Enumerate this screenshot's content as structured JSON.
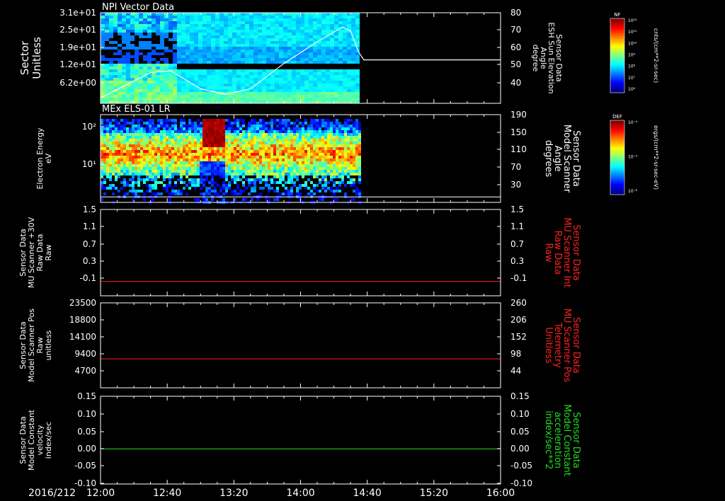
{
  "date_label": "2016/212",
  "time_ticks": [
    "12:00",
    "12:40",
    "13:20",
    "14:00",
    "14:40",
    "15:20",
    "16:00"
  ],
  "panels": [
    {
      "title": "NPI Vector Data",
      "ylabel_lines": [
        "Sector",
        "Unitless"
      ],
      "left_ticks": [
        "3.1e+01",
        "2.5e+01",
        "1.9e+01",
        "1.2e+01",
        "6.2e+00"
      ],
      "right_ticks": [
        "80",
        "70",
        "60",
        "50",
        "40"
      ],
      "right_label_lines": [
        "Sensor Data",
        "ESH Sun Elevation",
        "Angle",
        "degree"
      ],
      "right_label_color": "#ffffff",
      "colorbar": {
        "tag": "NF",
        "unit": "cnts/(cm**2-sr-sec)",
        "labels": [
          "10¹²",
          "10¹¹",
          "10¹⁰",
          "10⁹",
          "10⁸",
          "10⁷",
          "10⁶"
        ]
      }
    },
    {
      "title": "MEx ELS-01 LR",
      "ylabel_lines": [
        "Electron Energy",
        "eV"
      ],
      "left_ticks": [
        "10²",
        "10¹"
      ],
      "right_ticks": [
        "190",
        "150",
        "110",
        "70",
        "30"
      ],
      "right_label_lines": [
        "Sensor Data",
        "Model Scanner",
        "Angle",
        "degrees"
      ],
      "right_label_color": "#ffffff",
      "colorbar": {
        "tag": "DEF",
        "unit": "ergs/(cm**2-sr-sec-eV)",
        "labels": [
          "10⁻⁴",
          "10⁻⁵",
          "10⁻⁶"
        ]
      }
    },
    {
      "ylabel_lines": [
        "Sensor Data",
        "MU Scanner +30V",
        "Raw Data",
        "Raw"
      ],
      "left_ticks": [
        "1.5",
        "1.1",
        "0.7",
        "0.3",
        "-0.1"
      ],
      "right_ticks": [
        "1.5",
        "1.1",
        "0.7",
        "0.3",
        "-0.1"
      ],
      "right_label_lines": [
        "Sensor Data",
        "MU Scanner Int",
        "Raw Data",
        "Raw"
      ],
      "right_label_color": "#ff2020"
    },
    {
      "ylabel_lines": [
        "Sensor Data",
        "Model Scanner Pos",
        "Raw",
        "unitless"
      ],
      "left_ticks": [
        "23500",
        "18800",
        "14100",
        "9400",
        "4700"
      ],
      "right_ticks": [
        "260",
        "206",
        "152",
        "98",
        "44"
      ],
      "right_label_lines": [
        "Sensor Data",
        "MU Scanner Pos",
        "Telemetry",
        "Unitless"
      ],
      "right_label_color": "#ff2020"
    },
    {
      "ylabel_lines": [
        "Sensor Data",
        "Model Constant",
        "velocity",
        "index/sec"
      ],
      "left_ticks": [
        "0.15",
        "0.10",
        "0.05",
        "0.00",
        "-0.05",
        "-0.10"
      ],
      "right_ticks": [
        "0.15",
        "0.10",
        "0.05",
        "0.00",
        "-0.05",
        "-0.10"
      ],
      "right_label_lines": [
        "Sensor Data",
        "Model Constant",
        "acceleration",
        "index/sec**2"
      ],
      "right_label_color": "#22dd22"
    }
  ],
  "chart_data": [
    {
      "type": "heatmap",
      "title": "NPI Vector Data",
      "ylabel": "Sector Unitless",
      "y2label": "Sensor Data ESH Sun Elevation Angle degree",
      "x_range": [
        "12:00",
        "16:00"
      ],
      "ylim": [
        0,
        31
      ],
      "y2lim": [
        30,
        80
      ],
      "data_end": "14:35",
      "line_series": {
        "name": "ESH Sun Elevation Angle",
        "color": "#ffffff",
        "x": [
          "12:00",
          "12:15",
          "12:30",
          "12:42",
          "13:00",
          "13:15",
          "13:30",
          "13:50",
          "14:10",
          "14:25",
          "14:30",
          "14:35",
          "14:38",
          "16:00"
        ],
        "y": [
          33,
          40,
          47,
          48,
          38,
          35,
          38,
          52,
          64,
          72,
          70,
          58,
          54,
          54
        ]
      }
    },
    {
      "type": "heatmap",
      "title": "MEx ELS-01 LR",
      "ylabel": "Electron Energy eV",
      "y2label": "Sensor Data Model Scanner Angle degrees",
      "yscale": "log",
      "x_range": [
        "12:00",
        "16:00"
      ],
      "y2lim": [
        0,
        190
      ],
      "data_end": "14:35",
      "line_series": {
        "name": "Model Scanner Angle",
        "color": "#ffffff",
        "x": [
          "12:00",
          "16:00"
        ],
        "y": [
          12,
          12
        ]
      }
    },
    {
      "type": "line",
      "ylabel": "Sensor Data MU Scanner +30V Raw Data Raw",
      "y2label": "Sensor Data MU Scanner Int Raw Data Raw",
      "ylim": [
        -0.3,
        1.5
      ],
      "series": [
        {
          "color": "#ff2020",
          "x": [
            "12:00",
            "16:00"
          ],
          "y": [
            0,
            0
          ]
        }
      ]
    },
    {
      "type": "line",
      "ylabel": "Sensor Data Model Scanner Pos Raw unitless",
      "y2label": "Sensor Data MU Scanner Pos Telemetry Unitless",
      "ylim": [
        0,
        23500
      ],
      "series": [
        {
          "color": "#ff2020",
          "x": [
            "12:00",
            "16:00"
          ],
          "y": [
            8000,
            8000
          ]
        }
      ]
    },
    {
      "type": "line",
      "ylabel": "Sensor Data Model Constant velocity index/sec",
      "y2label": "Sensor Data Model Constant acceleration index/sec**2",
      "ylim": [
        -0.1,
        0.15
      ],
      "series": [
        {
          "color": "#22dd22",
          "x": [
            "12:00",
            "16:00"
          ],
          "y": [
            0,
            0
          ]
        }
      ]
    }
  ]
}
